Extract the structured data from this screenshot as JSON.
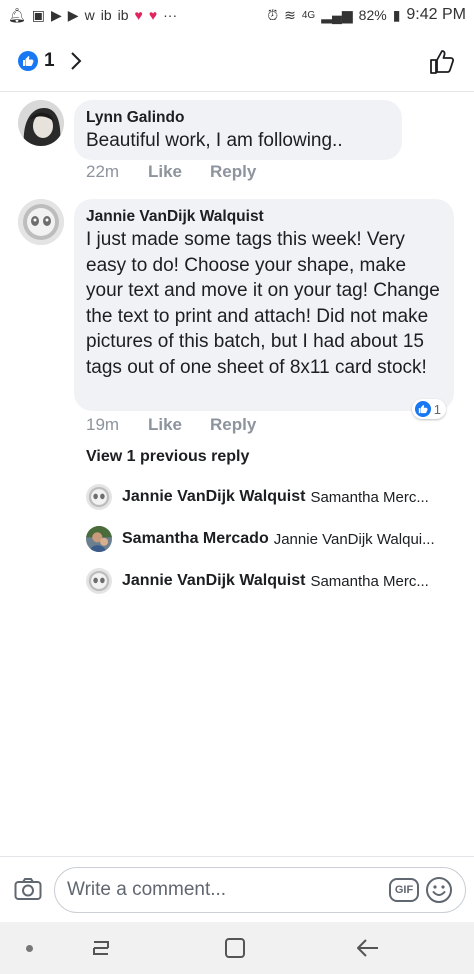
{
  "status_bar": {
    "battery": "82%",
    "network": "4G",
    "time": "9:42 PM",
    "more": "···"
  },
  "header": {
    "like_count": "1"
  },
  "comments": [
    {
      "author": "Lynn Galindo",
      "text": "Beautiful work, I am following..",
      "time": "22m",
      "like_label": "Like",
      "reply_label": "Reply"
    },
    {
      "author": "Jannie VanDijk Walquist",
      "text": "I just made some tags this week! Very easy to do! Choose your shape, make your text and move it on your tag! Change the text to print and attach! Did not make pictures of this batch, but I had about 15 tags out of one sheet of 8x11 card stock!",
      "time": "19m",
      "like_label": "Like",
      "reply_label": "Reply",
      "reaction_count": "1"
    }
  ],
  "view_previous": "View 1 previous reply",
  "replies": [
    {
      "author": "Jannie VanDijk Walquist",
      "text": "Samantha Merc..."
    },
    {
      "author": "Samantha Mercado",
      "text": "Jannie VanDijk Walqui..."
    },
    {
      "author": "Jannie VanDijk Walquist",
      "text": "Samantha Merc..."
    }
  ],
  "composer": {
    "placeholder": "Write a comment...",
    "gif_label": "GIF"
  },
  "colors": {
    "accent": "#1877f2",
    "bubble": "#f0f2f5",
    "muted": "#8d949e"
  }
}
